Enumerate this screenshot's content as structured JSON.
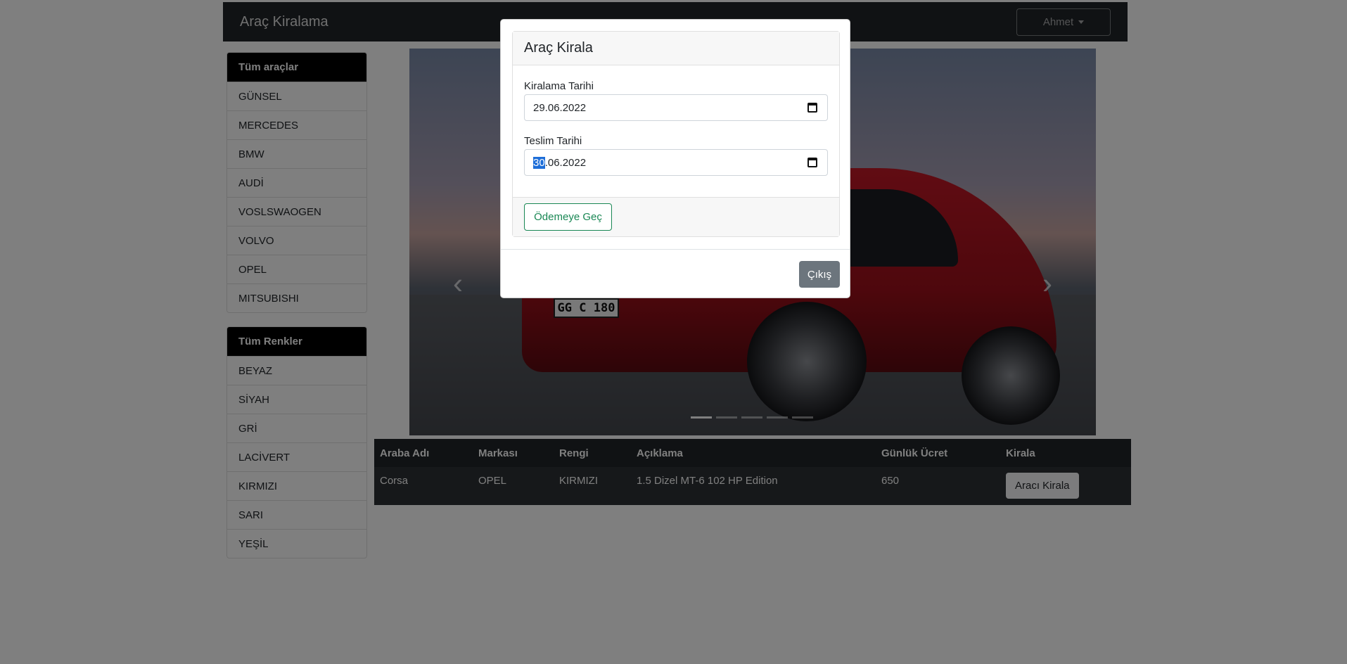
{
  "navbar": {
    "brand": "Araç Kiralama",
    "user_label": "Ahmet"
  },
  "sidebar": {
    "brands_header": "Tüm araçlar",
    "brands": [
      "GÜNSEL",
      "MERCEDES",
      "BMW",
      "AUDİ",
      "VOSLSWAOGEN",
      "VOLVO",
      "OPEL",
      "MITSUBISHI"
    ],
    "colors_header": "Tüm Renkler",
    "colors": [
      "BEYAZ",
      "SİYAH",
      "GRİ",
      "LACİVERT",
      "KIRMIZI",
      "SARI",
      "YEŞİL"
    ]
  },
  "carousel": {
    "plate_text": "GG C 180",
    "slide_count": 5,
    "active_slide": 1,
    "prev_icon": "chevron-left-icon",
    "next_icon": "chevron-right-icon"
  },
  "table": {
    "headers": [
      "Araba Adı",
      "Markası",
      "Rengi",
      "Açıklama",
      "Günlük Ücret",
      "Kirala"
    ],
    "rows": [
      {
        "name": "Corsa",
        "brand": "OPEL",
        "color": "KIRMIZI",
        "description": "1.5 Dizel MT-6 102 HP Edition",
        "daily_price": "650",
        "action": "Aracı Kirala"
      }
    ]
  },
  "modal": {
    "title": "Araç Kirala",
    "rent_date_label": "Kiralama Tarihi",
    "rent_date_value": "29.06.2022",
    "return_date_label": "Teslim Tarihi",
    "return_date_day": "30",
    "return_date_rest": ".06.2022",
    "pay_button": "Ödemeye Geç",
    "exit_button": "Çıkış"
  },
  "colors": {
    "navbar": "#212529",
    "active_item": "#000000",
    "success": "#198754",
    "secondary": "#6c757d",
    "selection": "#1e6ed8"
  }
}
